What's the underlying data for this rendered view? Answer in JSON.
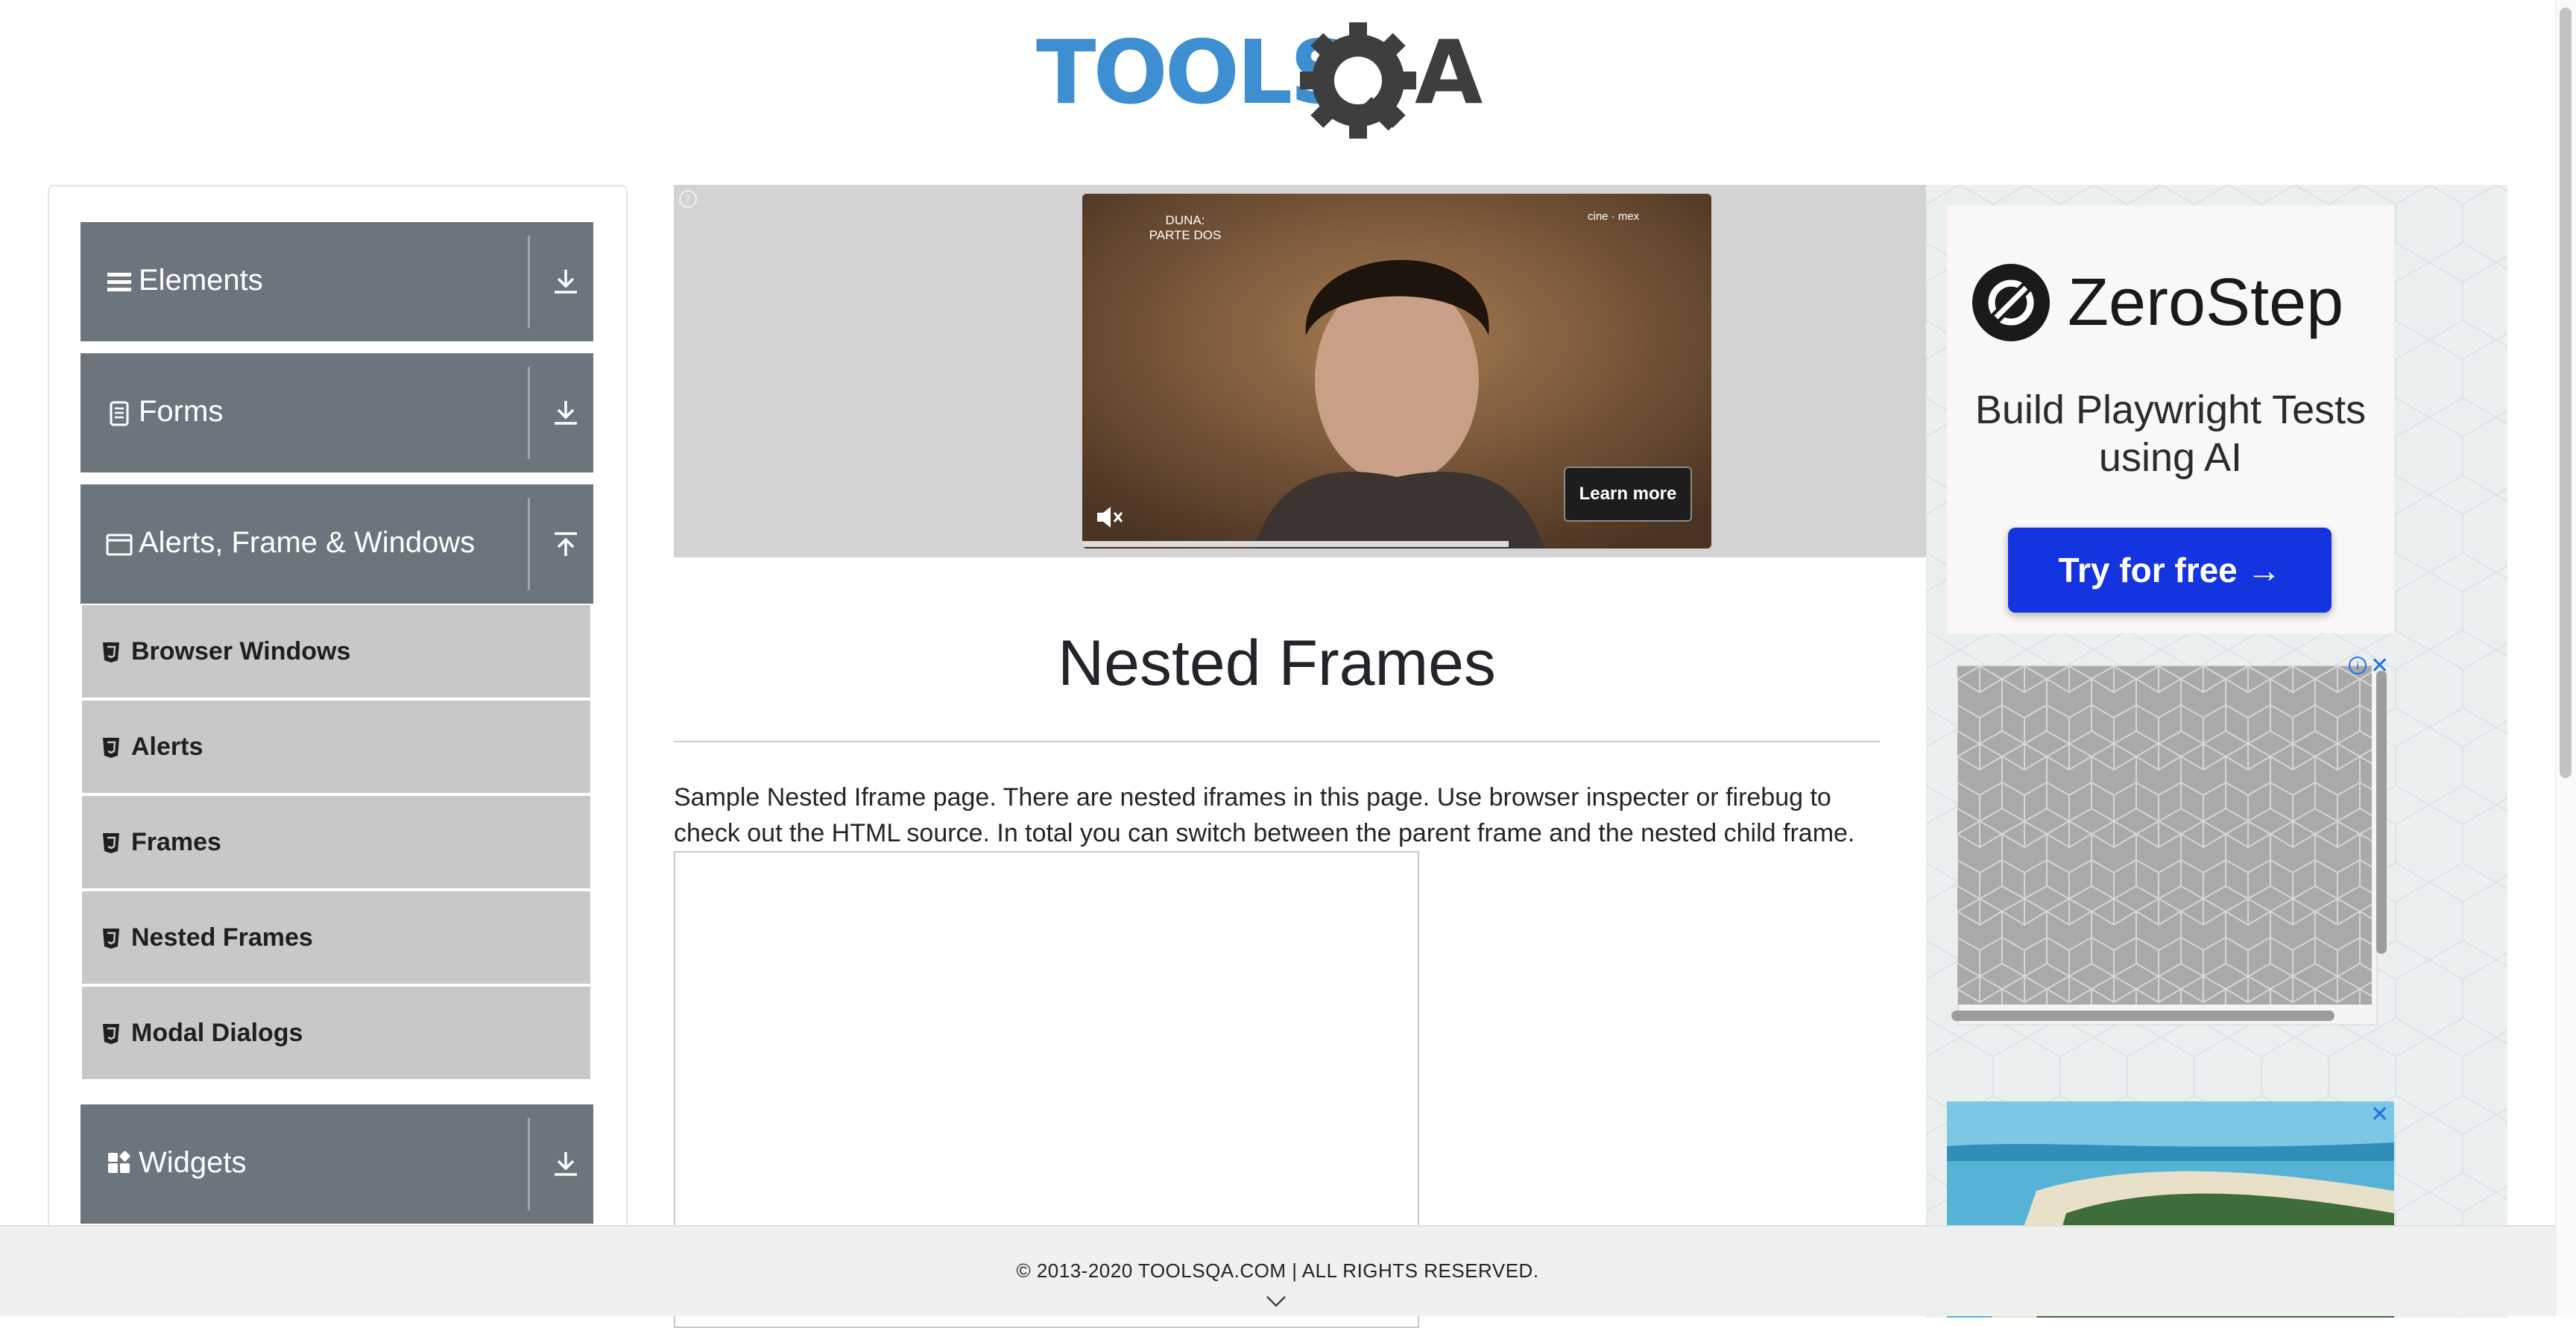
{
  "header": {
    "logo_text": "TOOLSQA"
  },
  "sidebar": {
    "groups": [
      {
        "label": "Elements",
        "icon": "hamburger-icon",
        "arrow": "download-arrow-icon"
      },
      {
        "label": "Forms",
        "icon": "form-icon",
        "arrow": "download-arrow-icon"
      },
      {
        "label": "Alerts, Frame & Windows",
        "icon": "window-icon",
        "arrow": "upload-arrow-icon"
      },
      {
        "label": "Widgets",
        "icon": "widgets-icon",
        "arrow": "download-arrow-icon"
      }
    ],
    "items": [
      {
        "label": "Browser Windows"
      },
      {
        "label": "Alerts"
      },
      {
        "label": "Frames"
      },
      {
        "label": "Nested Frames"
      },
      {
        "label": "Modal Dialogs"
      }
    ]
  },
  "ad_banner": {
    "video_caption": "DUNA:\nPARTE DOS",
    "video_brand": "cine · mex",
    "learn_more": "Learn more"
  },
  "main": {
    "title": "Nested Frames",
    "description": "Sample Nested Iframe page. There are nested iframes in this page. Use browser inspecter or firebug to check out the HTML source. In total you can switch between the parent frame and the nested child frame."
  },
  "right_ad": {
    "brand": "ZeroStep",
    "tagline": "Build Playwright Tests using AI",
    "button": "Try for free →",
    "close": "✕"
  },
  "footer": {
    "text": "© 2013-2020 TOOLSQA.COM | ALL RIGHTS RESERVED."
  },
  "colors": {
    "sidebar_header_bg": "#6c757d",
    "sidebar_item_bg": "#c8c8c8",
    "logo_blue": "#3d8fd1",
    "logo_dark": "#3e3e3e",
    "cta_blue": "#1434e0"
  }
}
